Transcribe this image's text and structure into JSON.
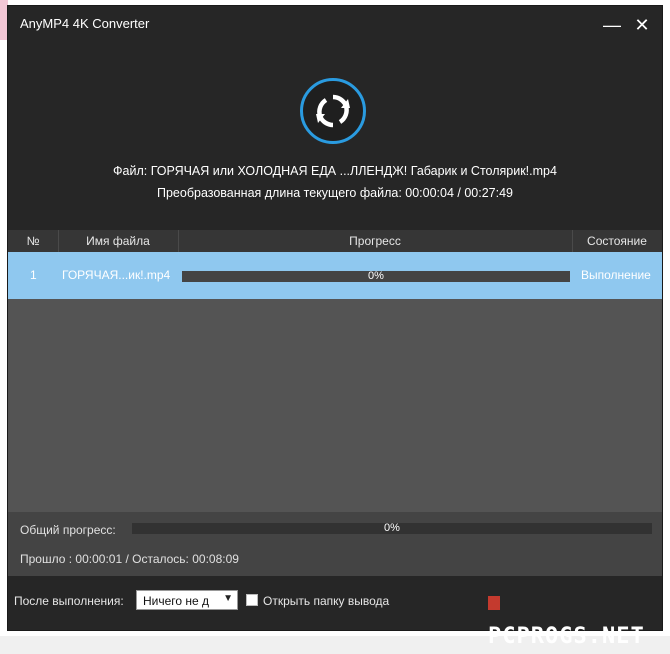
{
  "window": {
    "title": "AnyMP4 4K Converter",
    "minimize_glyph": "—",
    "close_glyph": "✕"
  },
  "header": {
    "file_line": "Файл: ГОРЯЧАЯ или ХОЛОДНАЯ ЕДА ...ЛЛЕНДЖ! Габарик и Столярик!.mp4",
    "length_line": "Преобразованная длина текущего файла: 00:00:04 / 00:27:49",
    "icon": "convert-refresh-icon"
  },
  "table": {
    "columns": [
      "№",
      "Имя файла",
      "Прогресс",
      "Состояние"
    ],
    "rows": [
      {
        "num": "1",
        "filename": "ГОРЯЧАЯ...ик!.mp4",
        "progress_pct": "0%",
        "progress": 0,
        "status": "Выполнение"
      }
    ]
  },
  "overall": {
    "label": "Общий прогресс:",
    "pct": "0%",
    "progress": 0,
    "time_line": "Прошло : 00:00:01 / Осталось: 00:08:09"
  },
  "footer": {
    "after_label": "После выполнения:",
    "after_value": "Ничего не д",
    "open_folder_label": "Открыть папку вывода",
    "open_folder_checked": false,
    "watermark": "PCPROGS.NET"
  },
  "colors": {
    "accent": "#2a9be0",
    "row_selected": "#8fc8ef",
    "bg_dark": "#262626",
    "body_gray": "#545454"
  }
}
